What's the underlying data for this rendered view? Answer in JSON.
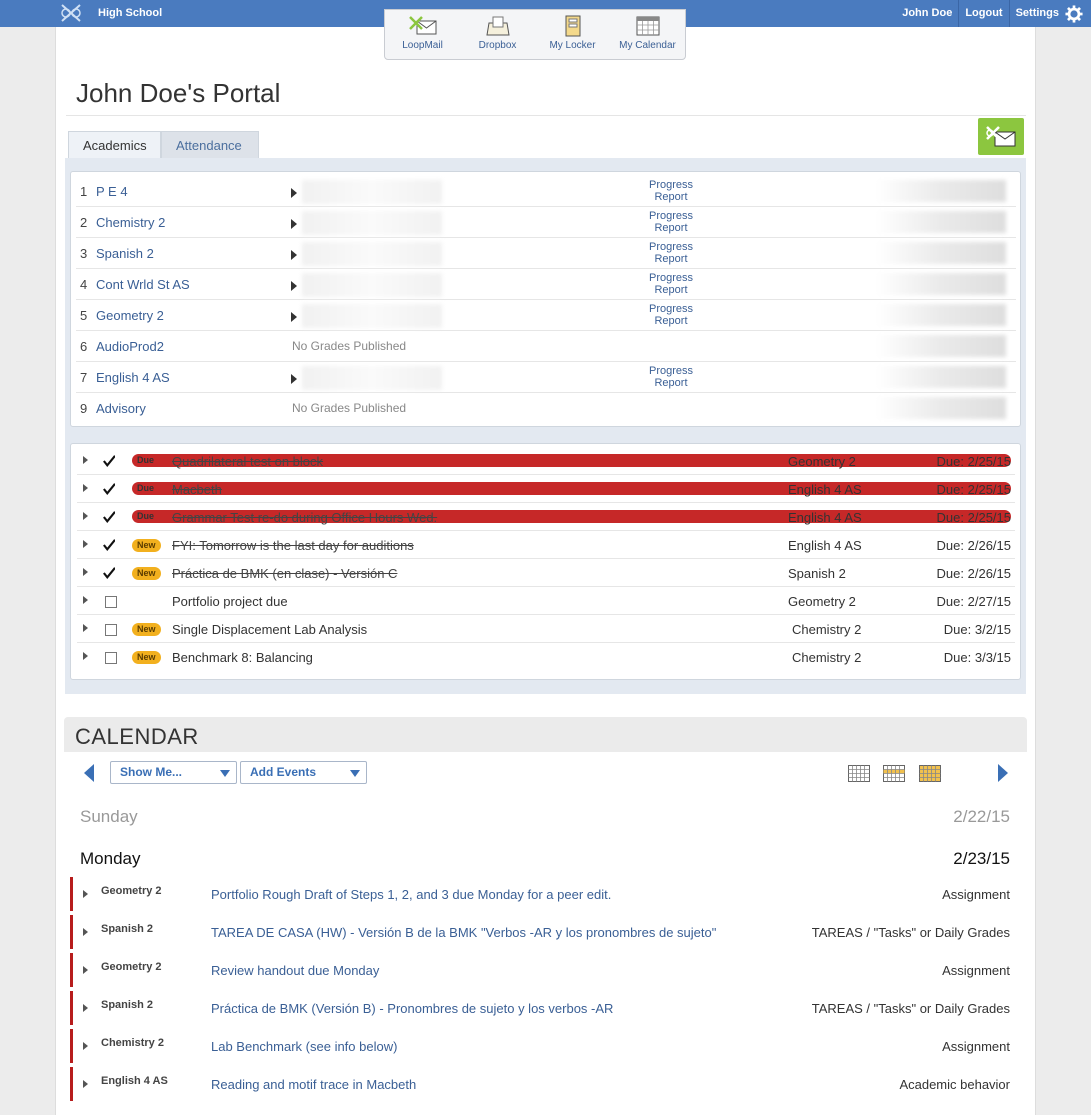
{
  "topbar": {
    "school": "High School",
    "user": "John Doe",
    "logout": "Logout",
    "settings": "Settings"
  },
  "launcher": [
    {
      "label": "LoopMail",
      "icon": "loopmail-icon"
    },
    {
      "label": "Dropbox",
      "icon": "dropbox-icon"
    },
    {
      "label": "My Locker",
      "icon": "locker-icon"
    },
    {
      "label": "My Calendar",
      "icon": "calendar-icon"
    }
  ],
  "page": {
    "title": "John Doe's Portal"
  },
  "tabs": {
    "academics": "Academics",
    "attendance": "Attendance"
  },
  "grades": [
    {
      "period": "1",
      "course": "P E 4",
      "progress": "Progress Report"
    },
    {
      "period": "2",
      "course": "Chemistry 2",
      "progress": "Progress Report"
    },
    {
      "period": "3",
      "course": "Spanish 2",
      "progress": "Progress Report"
    },
    {
      "period": "4",
      "course": "Cont Wrld St AS",
      "progress": "Progress Report"
    },
    {
      "period": "5",
      "course": "Geometry 2",
      "progress": "Progress Report"
    },
    {
      "period": "6",
      "course": "AudioProd2",
      "nogrades": "No Grades Published"
    },
    {
      "period": "7",
      "course": "English 4 AS",
      "progress": "Progress Report"
    },
    {
      "period": "9",
      "course": "Advisory",
      "nogrades": "No Grades Published"
    }
  ],
  "tasks": [
    {
      "checked": true,
      "badge": "Due",
      "title": "Quadrilateral test on block",
      "course": "Geometry 2",
      "due": "Due: 2/25/15"
    },
    {
      "checked": true,
      "badge": "Due",
      "title": "Macbeth",
      "course": "English 4 AS",
      "due": "Due: 2/25/15"
    },
    {
      "checked": true,
      "badge": "Due",
      "title": "Grammar Test re-do during Office Hours Wed.",
      "course": "English 4 AS",
      "due": "Due: 2/25/15"
    },
    {
      "checked": true,
      "badge": "New",
      "title": "FYI: Tomorrow is the last day for auditions",
      "course": "English 4 AS",
      "due": "Due: 2/26/15"
    },
    {
      "checked": true,
      "badge": "New",
      "title": "Práctica de BMK (en clase) - Versión C",
      "course": "Spanish 2",
      "due": "Due: 2/26/15"
    },
    {
      "checked": false,
      "badge": "",
      "title": "Portfolio project due",
      "course": "Geometry 2",
      "due": "Due: 2/27/15"
    },
    {
      "checked": false,
      "badge": "New",
      "title": "Single Displacement Lab Analysis",
      "course": "Chemistry 2",
      "due": "Due: 3/2/15"
    },
    {
      "checked": false,
      "badge": "New",
      "title": "Benchmark 8: Balancing",
      "course": "Chemistry 2",
      "due": "Due: 3/3/15"
    }
  ],
  "calendar": {
    "title": "CALENDAR",
    "show_me": "Show Me...",
    "add_events": "Add Events",
    "days": [
      {
        "name": "Sunday",
        "date": "2/22/15"
      },
      {
        "name": "Monday",
        "date": "2/23/15"
      }
    ],
    "events": [
      {
        "course": "Geometry 2",
        "title": "Portfolio Rough Draft of Steps 1, 2, and 3 due Monday for a peer edit.",
        "category": "Assignment"
      },
      {
        "course": "Spanish 2",
        "title": "TAREA DE CASA (HW) - Versión B de la BMK \"Verbos -AR y los pronombres de sujeto\"",
        "category": "TAREAS / \"Tasks\" or Daily Grades"
      },
      {
        "course": "Geometry 2",
        "title": "Review handout due Monday",
        "category": "Assignment"
      },
      {
        "course": "Spanish 2",
        "title": "Práctica de BMK (Versión B) - Pronombres de sujeto y los verbos -AR",
        "category": "TAREAS / \"Tasks\" or Daily Grades"
      },
      {
        "course": "Chemistry 2",
        "title": "Lab Benchmark (see info below)",
        "category": "Assignment"
      },
      {
        "course": "English 4 AS",
        "title": "Reading and motif trace in Macbeth",
        "category": "Academic behavior"
      }
    ]
  },
  "colors": {
    "topbar": "#4a7bbf",
    "link": "#3a5f95",
    "due_badge": "#c62828",
    "new_badge": "#f2b01e",
    "loopmail_button": "#8cc63f",
    "event_bar": "#b71c1c"
  }
}
